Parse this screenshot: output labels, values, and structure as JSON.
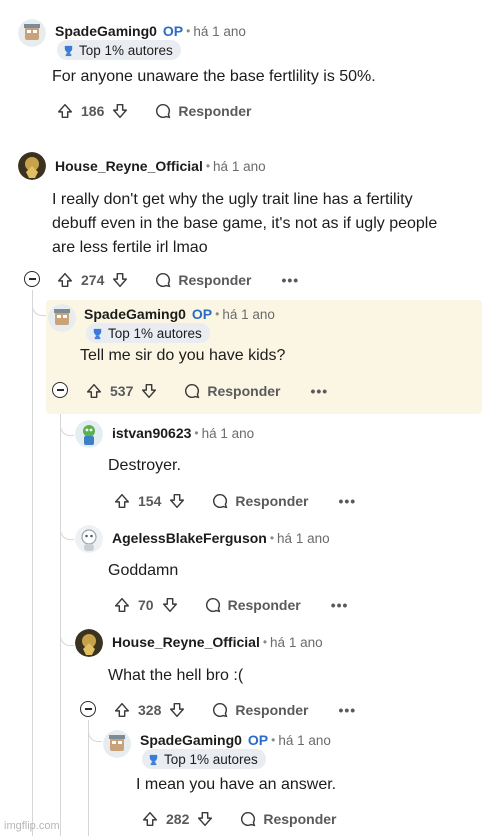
{
  "comments": [
    {
      "author": "SpadeGaming0",
      "op": "OP",
      "time": "há 1 ano",
      "flair": "Top 1% autores",
      "body": [
        "For anyone unaware the base fertlility is 50%."
      ],
      "votes": "186",
      "reply": "Responder"
    },
    {
      "author": "House_Reyne_Official",
      "time": "há 1 ano",
      "body": [
        "I really don't get why the ugly trait line has a fertility",
        "debuff even in the base game, it's not as if ugly people",
        "are less fertile irl lmao"
      ],
      "votes": "274",
      "reply": "Responder",
      "more": "•••"
    },
    {
      "author": "SpadeGaming0",
      "op": "OP",
      "time": "há 1 ano",
      "flair": "Top 1% autores",
      "body": [
        "Tell me sir do you have kids?"
      ],
      "votes": "537",
      "reply": "Responder",
      "more": "•••"
    },
    {
      "author": "istvan90623",
      "time": "há 1 ano",
      "body": [
        "Destroyer."
      ],
      "votes": "154",
      "reply": "Responder",
      "more": "•••"
    },
    {
      "author": "AgelessBlakeFerguson",
      "time": "há 1 ano",
      "body": [
        "Goddamn"
      ],
      "votes": "70",
      "reply": "Responder",
      "more": "•••"
    },
    {
      "author": "House_Reyne_Official",
      "time": "há 1 ano",
      "body": [
        "What the hell bro :("
      ],
      "votes": "328",
      "reply": "Responder",
      "more": "•••"
    },
    {
      "author": "SpadeGaming0",
      "op": "OP",
      "time": "há 1 ano",
      "flair": "Top 1% autores",
      "body": [
        "I mean you have an answer."
      ],
      "votes": "282",
      "reply": "Responder"
    }
  ],
  "watermark": "imgflip.com",
  "colors": {
    "op": "#2a6bc6",
    "highlight": "#fbf6e3",
    "thread_line": "#d6d6d6"
  }
}
